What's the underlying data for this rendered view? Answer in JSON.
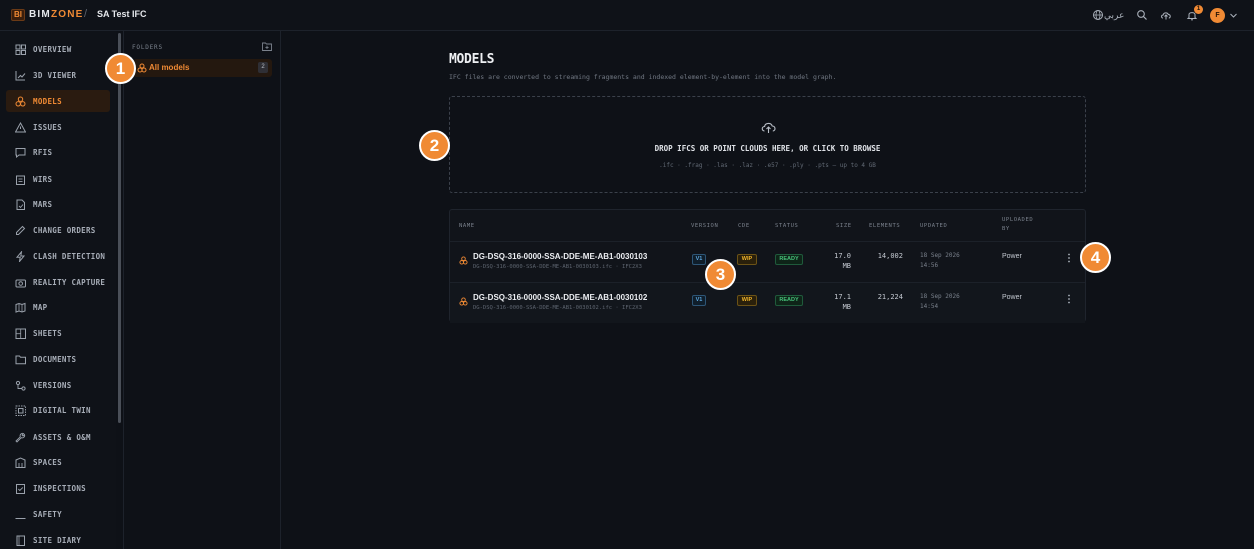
{
  "topbar": {
    "logo_mark": "BI",
    "logo_prefix": "BIM",
    "logo_suffix": "ZONE",
    "separator": "/",
    "project": "SA Test IFC",
    "language_label": "عربي",
    "notifications_count": "1",
    "avatar_initial": "F"
  },
  "sidebar": {
    "items": [
      {
        "label": "OVERVIEW",
        "icon": "overview-icon"
      },
      {
        "label": "3D VIEWER",
        "icon": "chart-icon"
      },
      {
        "label": "MODELS",
        "icon": "models-icon",
        "active": true
      },
      {
        "label": "ISSUES",
        "icon": "warning-icon"
      },
      {
        "label": "RFIS",
        "icon": "chat-icon"
      },
      {
        "label": "WIRS",
        "icon": "clipboard-icon"
      },
      {
        "label": "MARS",
        "icon": "file-icon"
      },
      {
        "label": "CHANGE ORDERS",
        "icon": "edit-icon"
      },
      {
        "label": "CLASH DETECTION",
        "icon": "bolt-icon"
      },
      {
        "label": "REALITY CAPTURE",
        "icon": "camera-icon"
      },
      {
        "label": "MAP",
        "icon": "map-icon"
      },
      {
        "label": "SHEETS",
        "icon": "sheets-icon"
      },
      {
        "label": "DOCUMENTS",
        "icon": "folder-icon"
      },
      {
        "label": "VERSIONS",
        "icon": "versions-icon"
      },
      {
        "label": "DIGITAL TWIN",
        "icon": "twin-icon"
      },
      {
        "label": "ASSETS & O&M",
        "icon": "wrench-icon"
      },
      {
        "label": "SPACES",
        "icon": "spaces-icon"
      },
      {
        "label": "INSPECTIONS",
        "icon": "checklist-icon"
      },
      {
        "label": "SAFETY",
        "icon": "helmet-icon"
      },
      {
        "label": "SITE DIARY",
        "icon": "diary-icon"
      }
    ]
  },
  "folders": {
    "title": "FOLDERS",
    "items": [
      {
        "label": "All models",
        "count": "2"
      }
    ]
  },
  "main": {
    "title": "MODELS",
    "subtitle": "IFC files are converted to streaming fragments and indexed element-by-element into the model graph.",
    "dropzone": {
      "title": "DROP IFCS OR POINT CLOUDS HERE, OR CLICK TO BROWSE",
      "formats": ".ifc · .frag · .las · .laz · .e57 · .ply · .pts — up to 4 GB"
    },
    "table": {
      "headers": {
        "name": "NAME",
        "version": "VERSION",
        "cde": "CDE",
        "status": "STATUS",
        "size": "SIZE",
        "elements": "ELEMENTS",
        "updated": "UPDATED",
        "uploaded_by_1": "UPLOADED",
        "uploaded_by_2": "BY"
      },
      "rows": [
        {
          "name": "DG-DSQ-316-0000-SSA-DDE-ME-AB1-0030103",
          "sub": "DG-DSQ-316-0000-SSA-DDE-ME-AB1-0030103.ifc · IFC2X3",
          "version": "V1",
          "cde": "WIP",
          "status": "READY",
          "size_value": "17.0",
          "size_unit": "MB",
          "elements": "14,002",
          "updated_date": "18 Sep 2026",
          "updated_time": "14:56",
          "uploaded_by": "Power"
        },
        {
          "name": "DG-DSQ-316-0000-SSA-DDE-ME-AB1-0030102",
          "sub": "DG-DSQ-316-0000-SSA-DDE-ME-AB1-0030102.ifc · IFC2X3",
          "version": "V1",
          "cde": "WIP",
          "status": "READY",
          "size_value": "17.1",
          "size_unit": "MB",
          "elements": "21,224",
          "updated_date": "18 Sep 2026",
          "updated_time": "14:54",
          "uploaded_by": "Power"
        }
      ]
    }
  },
  "callouts": [
    "1",
    "2",
    "3",
    "4"
  ],
  "colors": {
    "accent": "#f08a34",
    "background": "#0e1117",
    "ready": "#47c27b",
    "wip": "#f0b429",
    "version": "#5ea7de"
  }
}
